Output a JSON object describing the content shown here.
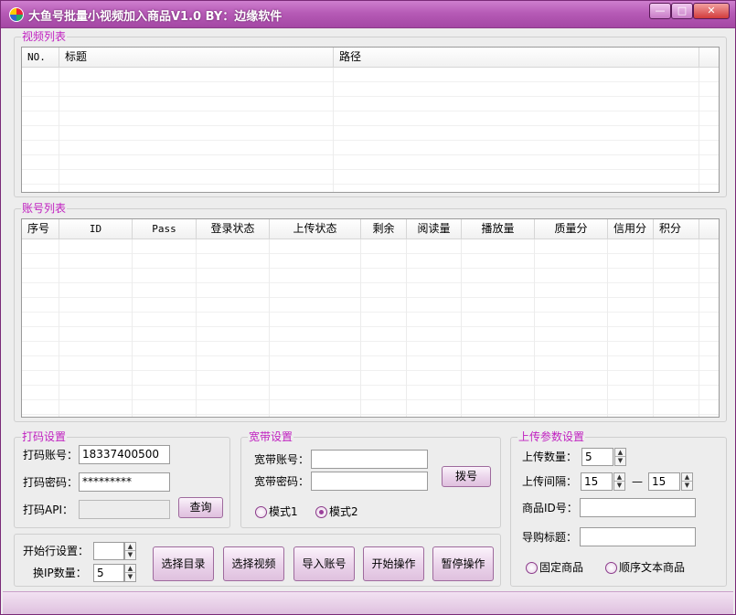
{
  "window": {
    "title": "大鱼号批量小视频加入商品V1.0 BY：边缘软件",
    "controls": {
      "minimize": "—",
      "maximize": "□",
      "close": "✕"
    }
  },
  "video_list": {
    "label": "视频列表",
    "columns": [
      "NO.",
      "标题",
      "路径"
    ]
  },
  "account_list": {
    "label": "账号列表",
    "columns": [
      "序号",
      "ID",
      "Pass",
      "登录状态",
      "上传状态",
      "剩余",
      "阅读量",
      "播放量",
      "质量分",
      "信用分",
      "积分"
    ]
  },
  "captcha": {
    "label": "打码设置",
    "account_label": "打码账号：",
    "account_value": "18337400500",
    "password_label": "打码密码：",
    "password_value": "*********",
    "api_label": "打码API：",
    "api_value": "",
    "query_button": "查询"
  },
  "broadband": {
    "label": "宽带设置",
    "account_label": "宽带账号：",
    "account_value": "",
    "password_label": "宽带密码：",
    "password_value": "",
    "dial_button": "拨号",
    "mode1": "模式1",
    "mode2": "模式2",
    "selected_mode": "模式2"
  },
  "controls": {
    "start_row_label": "开始行设置：",
    "start_row_value": "",
    "ip_count_label": "换IP数量：",
    "ip_count_value": "5",
    "buttons": [
      "选择目录",
      "选择视频",
      "导入账号",
      "开始操作",
      "暂停操作"
    ]
  },
  "upload": {
    "label": "上传参数设置",
    "count_label": "上传数量：",
    "count_value": "5",
    "interval_label": "上传间隔：",
    "interval_from": "15",
    "interval_sep": "—",
    "interval_to": "15",
    "product_id_label": "商品ID号：",
    "product_id_value": "",
    "guide_title_label": "导购标题：",
    "guide_title_value": "",
    "fixed_product": "固定商品",
    "sequential_text_product": "顺序文本商品"
  },
  "colors": {
    "accent": "#b65bb6",
    "group_label": "#c01fc0"
  }
}
